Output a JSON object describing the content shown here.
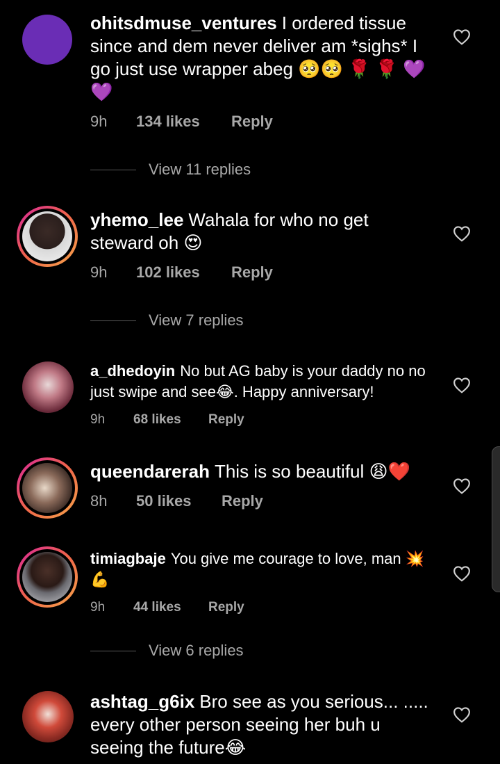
{
  "comments": [
    {
      "username": "ohitsdmuse_ventures",
      "text": "I ordered tissue since and dem never deliver am *sighs* I go just use wrapper abeg 🥺🥺 🌹 🌹 💜💜",
      "time": "9h",
      "likes": "134 likes",
      "reply": "Reply",
      "view_replies": "View 11 replies",
      "avatar_color": "#6a2db5"
    },
    {
      "username": "yhemo_lee",
      "text": "Wahala for who no get steward oh 😍",
      "time": "9h",
      "likes": "102 likes",
      "reply": "Reply",
      "view_replies": "View 7 replies"
    },
    {
      "username": "a_dhedoyin",
      "text": "No but AG baby is your daddy no no just swipe and see😂. Happy anniversary!",
      "time": "9h",
      "likes": "68 likes",
      "reply": "Reply"
    },
    {
      "username": "queendarerah",
      "text": "This is so beautiful 😩❤️",
      "time": "8h",
      "likes": "50 likes",
      "reply": "Reply"
    },
    {
      "username": "timiagbaje",
      "text": "You give me courage to love, man 💥💪",
      "time": "9h",
      "likes": "44 likes",
      "reply": "Reply",
      "view_replies": "View 6 replies"
    },
    {
      "username": "ashtag_g6ix",
      "text": "Bro see as you serious... ..... every other person seeing her buh u seeing the future😂"
    }
  ],
  "colors": {
    "background": "#000000",
    "text": "#ffffff",
    "meta": "#a8a8a8",
    "story_ring_start": "#d8269b",
    "story_ring_end": "#f6a64a"
  },
  "icons": {
    "like": "heart-outline-icon"
  }
}
